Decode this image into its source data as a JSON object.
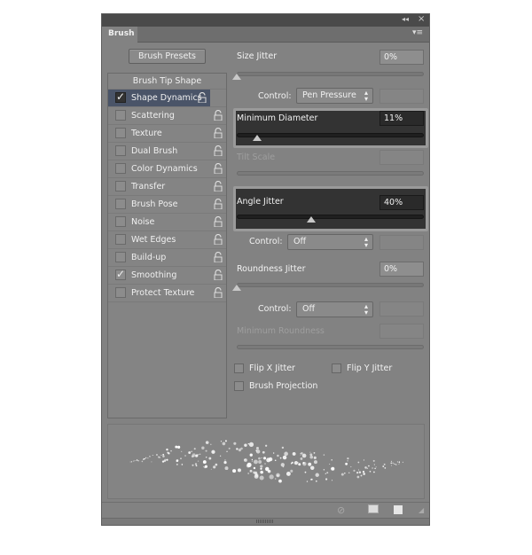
{
  "panel": {
    "tab": "Brush",
    "collapse_icon": "double-chevron-left-icon",
    "close_icon": "close-icon",
    "menu_icon": "panel-menu-icon"
  },
  "presets_button": "Brush Presets",
  "list": {
    "header": "Brush Tip Shape",
    "items": [
      {
        "label": "Shape Dynamics",
        "checked": true,
        "selected": true
      },
      {
        "label": "Scattering",
        "checked": false
      },
      {
        "label": "Texture",
        "checked": false
      },
      {
        "label": "Dual Brush",
        "checked": false
      },
      {
        "label": "Color Dynamics",
        "checked": false
      },
      {
        "label": "Transfer",
        "checked": false
      },
      {
        "label": "Brush Pose",
        "checked": false
      },
      {
        "label": "Noise",
        "checked": false
      },
      {
        "label": "Wet Edges",
        "checked": false
      },
      {
        "label": "Build-up",
        "checked": false
      },
      {
        "label": "Smoothing",
        "checked": true
      },
      {
        "label": "Protect Texture",
        "checked": false
      }
    ]
  },
  "settings": {
    "size_jitter": {
      "label": "Size Jitter",
      "value": "0%",
      "percent": 0
    },
    "control1": {
      "label": "Control:",
      "value": "Pen Pressure"
    },
    "min_diameter": {
      "label": "Minimum Diameter",
      "value": "11%",
      "percent": 11
    },
    "tilt_scale": {
      "label": "Tilt Scale"
    },
    "angle_jitter": {
      "label": "Angle Jitter",
      "value": "40%",
      "percent": 40
    },
    "control2": {
      "label": "Control:",
      "value": "Off"
    },
    "roundness_jitter": {
      "label": "Roundness Jitter",
      "value": "0%",
      "percent": 0
    },
    "control3": {
      "label": "Control:",
      "value": "Off"
    },
    "min_roundness": {
      "label": "Minimum Roundness"
    },
    "flip_x": {
      "label": "Flip X Jitter",
      "checked": false
    },
    "flip_y": {
      "label": "Flip Y Jitter",
      "checked": false
    },
    "projection": {
      "label": "Brush Projection",
      "checked": false
    }
  },
  "colors": {
    "highlight": "#333333",
    "panel": "#828282",
    "selected_item": "#4a5468"
  }
}
